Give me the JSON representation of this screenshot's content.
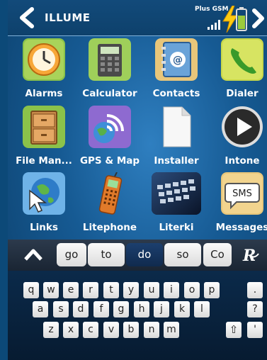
{
  "header": {
    "title": "ILLUME",
    "carrier": "Plus GSM",
    "back_icon": "chevron-left-icon",
    "forward_icon": "chevron-right-icon"
  },
  "apps": [
    {
      "label": "Alarms",
      "icon": "clock-icon"
    },
    {
      "label": "Calculator",
      "icon": "calculator-icon"
    },
    {
      "label": "Contacts",
      "icon": "address-book-icon"
    },
    {
      "label": "Dialer",
      "icon": "phone-icon"
    },
    {
      "label": "File Man...",
      "icon": "cabinet-icon"
    },
    {
      "label": "GPS & Map",
      "icon": "gps-icon"
    },
    {
      "label": "Installer",
      "icon": "document-icon"
    },
    {
      "label": "Intone",
      "icon": "play-icon"
    },
    {
      "label": "Links",
      "icon": "globe-cursor-icon"
    },
    {
      "label": "Litephone",
      "icon": "mobile-phone-icon"
    },
    {
      "label": "Literki",
      "icon": "keyboard-icon"
    },
    {
      "label": "Messages",
      "icon": "sms-icon",
      "badge": "SMS"
    }
  ],
  "suggestions": {
    "items": [
      "go",
      "to",
      "do",
      "so",
      "Co"
    ],
    "active_index": 2
  },
  "keyboard": {
    "row1": [
      "q",
      "w",
      "e",
      "r",
      "t",
      "y",
      "u",
      "i",
      "o",
      "p"
    ],
    "row2": [
      "a",
      "s",
      "d",
      "f",
      "g",
      "h",
      "j",
      "k",
      "l"
    ],
    "row3": [
      "z",
      "x",
      "c",
      "v",
      "b",
      "n",
      "m"
    ],
    "side": [
      ".",
      "?",
      "'"
    ],
    "shift": "⇧"
  }
}
